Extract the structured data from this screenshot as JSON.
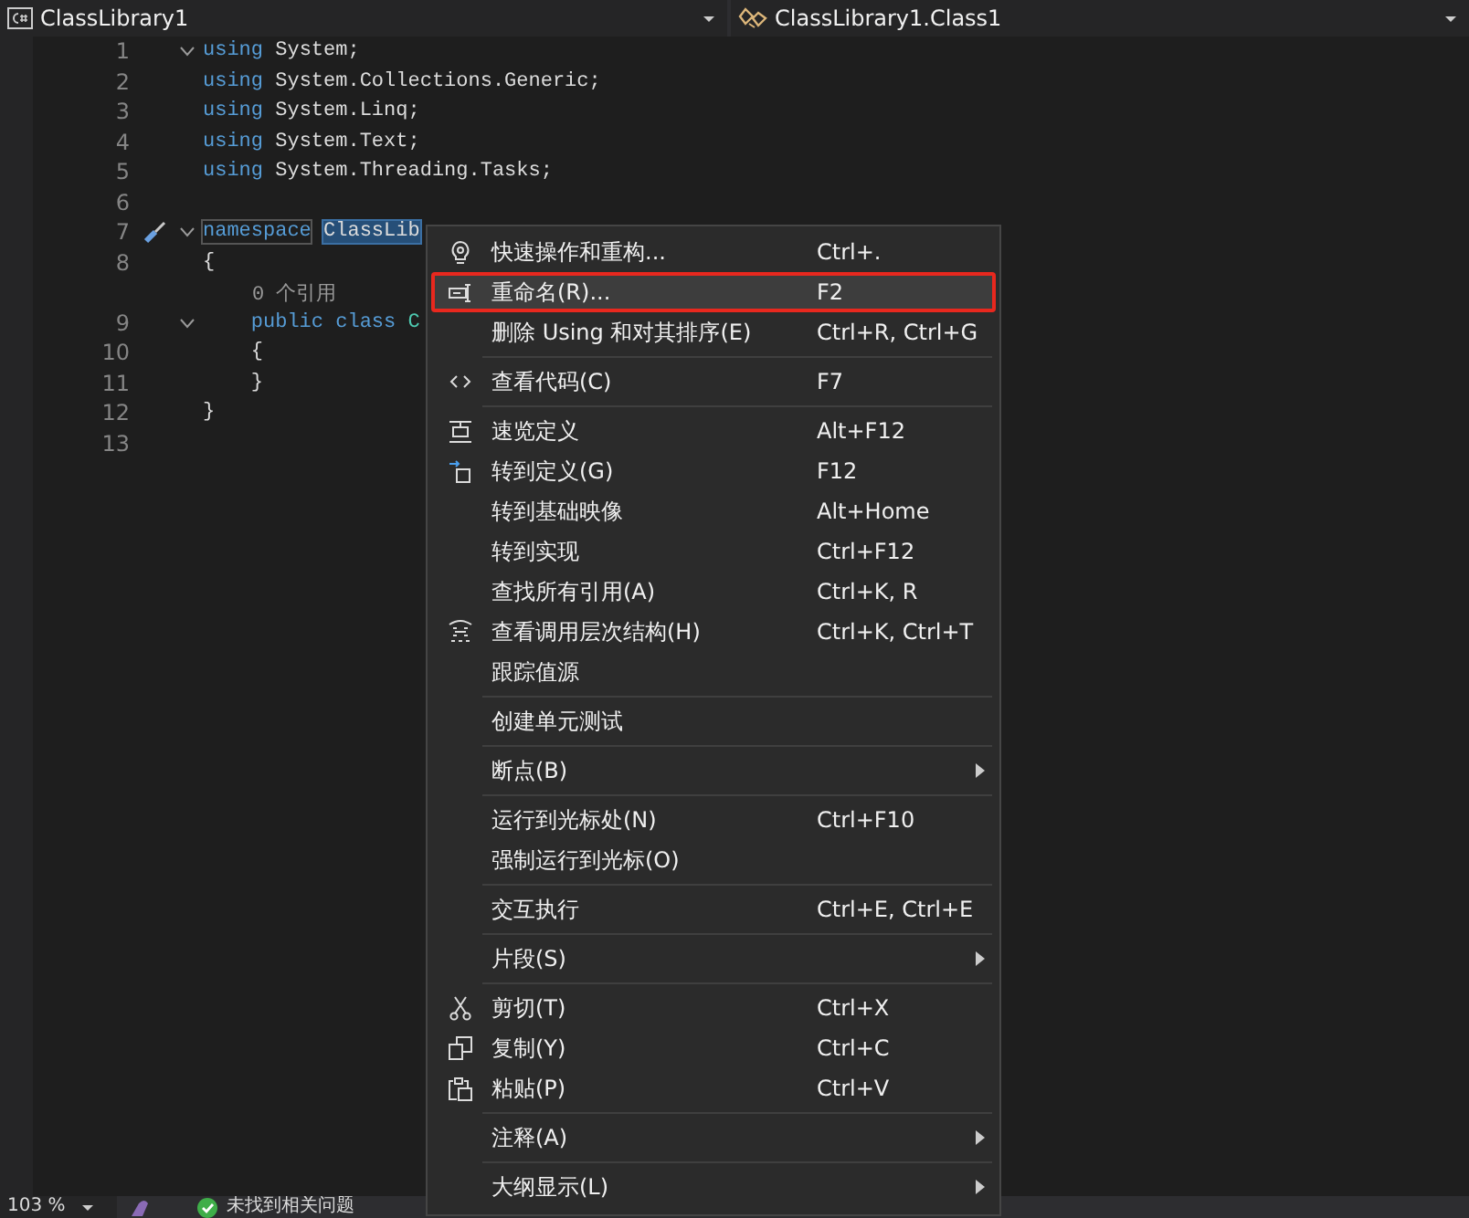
{
  "navigation_bar": {
    "project_dropdown": {
      "label": "ClassLibrary1"
    },
    "type_dropdown": {
      "label": "ClassLibrary1.Class1"
    }
  },
  "editor": {
    "lines": [
      {
        "number": "1",
        "fold": true,
        "tokens": [
          {
            "kind": "keyword",
            "text": "using"
          },
          {
            "kind": "plain",
            "text": " System;"
          }
        ]
      },
      {
        "number": "2",
        "fold": false,
        "tokens": [
          {
            "kind": "keyword",
            "text": "using"
          },
          {
            "kind": "plain",
            "text": " System.Collections.Generic;"
          }
        ]
      },
      {
        "number": "3",
        "fold": false,
        "tokens": [
          {
            "kind": "keyword",
            "text": "using"
          },
          {
            "kind": "plain",
            "text": " System.Linq;"
          }
        ]
      },
      {
        "number": "4",
        "fold": false,
        "tokens": [
          {
            "kind": "keyword",
            "text": "using"
          },
          {
            "kind": "plain",
            "text": " System.Text;"
          }
        ]
      },
      {
        "number": "5",
        "fold": false,
        "tokens": [
          {
            "kind": "keyword",
            "text": "using"
          },
          {
            "kind": "plain",
            "text": " System.Threading.Tasks;"
          }
        ]
      },
      {
        "number": "6",
        "fold": false
      },
      {
        "number": "7",
        "fold": true,
        "quick_action": true,
        "tokens": [
          {
            "kind": "keyword-boxed",
            "text": "namespace"
          },
          {
            "kind": "selected",
            "text": " ClassLib"
          }
        ]
      },
      {
        "number": "8",
        "fold": false,
        "tokens": [
          {
            "kind": "plain",
            "text": "{"
          }
        ]
      },
      {
        "fold": false,
        "codelens": "0 个引用"
      },
      {
        "number": "9",
        "fold": true,
        "tokens": [
          {
            "kind": "keyword",
            "text": "    public class"
          },
          {
            "kind": "type",
            "text": " C"
          }
        ]
      },
      {
        "number": "10",
        "fold": false,
        "tokens": [
          {
            "kind": "plain",
            "text": "    {"
          }
        ]
      },
      {
        "number": "11",
        "fold": false,
        "tokens": [
          {
            "kind": "plain",
            "text": "    }"
          }
        ]
      },
      {
        "number": "12",
        "fold": false,
        "tokens": [
          {
            "kind": "plain",
            "text": "}"
          }
        ]
      },
      {
        "number": "13",
        "fold": false
      }
    ]
  },
  "context_menu": {
    "groups": [
      [
        {
          "label": "快速操作和重构...",
          "shortcut": "Ctrl+.",
          "submenu": false,
          "selected": false
        },
        {
          "label": "重命名(R)...",
          "shortcut": "F2",
          "submenu": false,
          "selected": true
        },
        {
          "label": "删除 Using 和对其排序(E)",
          "shortcut": "Ctrl+R, Ctrl+G",
          "submenu": false,
          "selected": false
        }
      ],
      [
        {
          "label": "查看代码(C)",
          "shortcut": "F7",
          "submenu": false,
          "selected": false
        }
      ],
      [
        {
          "label": "速览定义",
          "shortcut": "Alt+F12",
          "submenu": false,
          "selected": false
        },
        {
          "label": "转到定义(G)",
          "shortcut": "F12",
          "submenu": false,
          "selected": false
        },
        {
          "label": "转到基础映像",
          "shortcut": "Alt+Home",
          "submenu": false,
          "selected": false
        },
        {
          "label": "转到实现",
          "shortcut": "Ctrl+F12",
          "submenu": false,
          "selected": false
        },
        {
          "label": "查找所有引用(A)",
          "shortcut": "Ctrl+K, R",
          "submenu": false,
          "selected": false
        },
        {
          "label": "查看调用层次结构(H)",
          "shortcut": "Ctrl+K, Ctrl+T",
          "submenu": false,
          "selected": false
        },
        {
          "label": "跟踪值源",
          "submenu": false,
          "selected": false
        }
      ],
      [
        {
          "label": "创建单元测试",
          "submenu": false,
          "selected": false
        }
      ],
      [
        {
          "label": "断点(B)",
          "submenu": true,
          "selected": false
        }
      ],
      [
        {
          "label": "运行到光标处(N)",
          "shortcut": "Ctrl+F10",
          "submenu": false,
          "selected": false
        },
        {
          "label": "强制运行到光标(O)",
          "submenu": false,
          "selected": false
        }
      ],
      [
        {
          "label": "交互执行",
          "shortcut": "Ctrl+E, Ctrl+E",
          "submenu": false,
          "selected": false
        }
      ],
      [
        {
          "label": "片段(S)",
          "submenu": true,
          "selected": false
        }
      ],
      [
        {
          "label": "剪切(T)",
          "shortcut": "Ctrl+X",
          "submenu": false,
          "selected": false
        },
        {
          "label": "复制(Y)",
          "shortcut": "Ctrl+C",
          "submenu": false,
          "selected": false
        },
        {
          "label": "粘贴(P)",
          "shortcut": "Ctrl+V",
          "submenu": false,
          "selected": false
        }
      ],
      [
        {
          "label": "注释(A)",
          "submenu": true,
          "selected": false
        }
      ],
      [
        {
          "label": "大纲显示(L)",
          "submenu": true,
          "selected": false
        }
      ]
    ]
  },
  "status_bar": {
    "zoom": "103 %",
    "issues": "未找到相关问题"
  }
}
